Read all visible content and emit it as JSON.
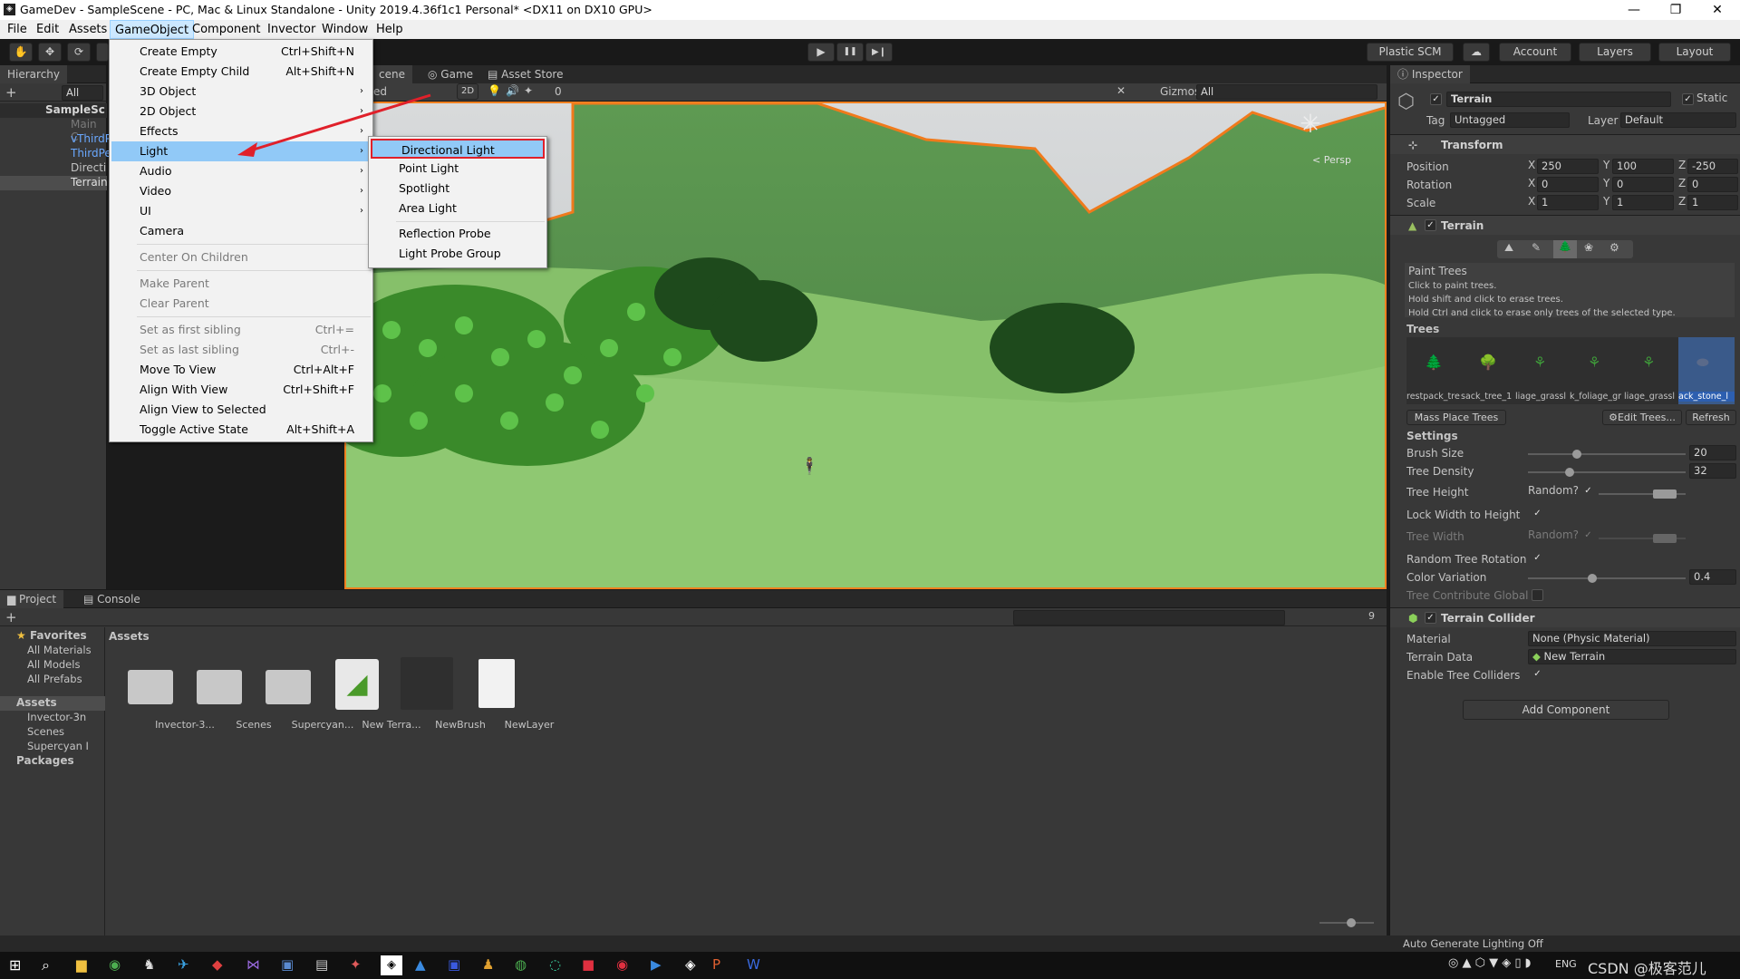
{
  "window": {
    "title": "GameDev - SampleScene - PC, Mac & Linux Standalone - Unity 2019.4.36f1c1 Personal* <DX11 on DX10 GPU>",
    "min": "—",
    "max": "❐",
    "close": "✕"
  },
  "menubar": [
    "File",
    "Edit",
    "Assets",
    "GameObject",
    "Component",
    "Invector",
    "Window",
    "Help"
  ],
  "toolbar": {
    "plastic": "Plastic SCM",
    "account": "Account",
    "layers": "Layers",
    "layout": "Layout",
    "play": "▶",
    "pause": "❚❚",
    "step": "▶❙"
  },
  "hierarchy": {
    "tab": "Hierarchy",
    "search": "All",
    "items": [
      "SampleSc",
      "Main C",
      "vThirdP",
      "ThirdPe",
      "Directi",
      "Terrain"
    ]
  },
  "scene": {
    "tabs": [
      "cene",
      "Game",
      "Asset Store"
    ],
    "shading": "ed",
    "mode2d": "2D",
    "hidden": "0",
    "gizmos": "Gizmos",
    "search": "All",
    "persp": "< Persp"
  },
  "gameobject_menu": {
    "items": [
      {
        "label": "Create Empty",
        "shortcut": "Ctrl+Shift+N",
        "sub": false,
        "disabled": false
      },
      {
        "label": "Create Empty Child",
        "shortcut": "Alt+Shift+N",
        "sub": false,
        "disabled": false
      },
      {
        "label": "3D Object",
        "shortcut": "",
        "sub": true,
        "disabled": false
      },
      {
        "label": "2D Object",
        "shortcut": "",
        "sub": true,
        "disabled": false
      },
      {
        "label": "Effects",
        "shortcut": "",
        "sub": true,
        "disabled": false
      },
      {
        "label": "Light",
        "shortcut": "",
        "sub": true,
        "disabled": false
      },
      {
        "label": "Audio",
        "shortcut": "",
        "sub": true,
        "disabled": false
      },
      {
        "label": "Video",
        "shortcut": "",
        "sub": true,
        "disabled": false
      },
      {
        "label": "UI",
        "shortcut": "",
        "sub": true,
        "disabled": false
      },
      {
        "label": "Camera",
        "shortcut": "",
        "sub": false,
        "disabled": false
      },
      {
        "label": "Center On Children",
        "shortcut": "",
        "sub": false,
        "disabled": true
      },
      {
        "label": "Make Parent",
        "shortcut": "",
        "sub": false,
        "disabled": true
      },
      {
        "label": "Clear Parent",
        "shortcut": "",
        "sub": false,
        "disabled": true
      },
      {
        "label": "Set as first sibling",
        "shortcut": "Ctrl+=",
        "sub": false,
        "disabled": true
      },
      {
        "label": "Set as last sibling",
        "shortcut": "Ctrl+-",
        "sub": false,
        "disabled": true
      },
      {
        "label": "Move To View",
        "shortcut": "Ctrl+Alt+F",
        "sub": false,
        "disabled": false
      },
      {
        "label": "Align With View",
        "shortcut": "Ctrl+Shift+F",
        "sub": false,
        "disabled": false
      },
      {
        "label": "Align View to Selected",
        "shortcut": "",
        "sub": false,
        "disabled": false
      },
      {
        "label": "Toggle Active State",
        "shortcut": "Alt+Shift+A",
        "sub": false,
        "disabled": false
      }
    ]
  },
  "light_submenu": [
    "Directional Light",
    "Point Light",
    "Spotlight",
    "Area Light",
    "Reflection Probe",
    "Light Probe Group"
  ],
  "inspector": {
    "tab": "Inspector",
    "object_name": "Terrain",
    "static": "Static",
    "tag_label": "Tag",
    "tag": "Untagged",
    "layer_label": "Layer",
    "layer": "Default",
    "transform": {
      "title": "Transform",
      "position": {
        "label": "Position",
        "x": "250",
        "y": "100",
        "z": "-250"
      },
      "rotation": {
        "label": "Rotation",
        "x": "0",
        "y": "0",
        "z": "0"
      },
      "scale": {
        "label": "Scale",
        "x": "1",
        "y": "1",
        "z": "1"
      }
    },
    "terrain": {
      "title": "Terrain",
      "paint_title": "Paint Trees",
      "help": [
        "Click to paint trees.",
        "Hold shift and click to erase trees.",
        "Hold Ctrl and click to erase only trees of the selected type."
      ],
      "trees_label": "Trees",
      "tree_items": [
        "restpack_tre",
        "sack_tree_1",
        "liage_grassl",
        "k_foliage_gr",
        "liage_grassl",
        "ack_stone_l"
      ],
      "mass_place": "Mass Place Trees",
      "edit_trees": "Edit Trees...",
      "refresh": "Refresh",
      "settings": "Settings",
      "brush_size": {
        "label": "Brush Size",
        "value": "20",
        "fraction": 0.3
      },
      "tree_density": {
        "label": "Tree Density",
        "value": "32",
        "fraction": 0.25
      },
      "tree_height": "Tree Height",
      "random": "Random?",
      "lock_width": "Lock Width to Height",
      "tree_width": "Tree Width",
      "random_rotation": "Random Tree Rotation",
      "color_variation": {
        "label": "Color Variation",
        "value": "0.4",
        "fraction": 0.4
      },
      "contribute_gi": "Tree Contribute Global I"
    },
    "collider": {
      "title": "Terrain Collider",
      "material_label": "Material",
      "material": "None (Physic Material)",
      "data_label": "Terrain Data",
      "data": "New Terrain",
      "enable_trees": "Enable Tree Colliders"
    },
    "add_component": "Add Component"
  },
  "project": {
    "tabs": [
      "Project",
      "Console"
    ],
    "favorites": "Favorites",
    "fav_items": [
      "All Materials",
      "All Models",
      "All Prefabs"
    ],
    "assets_root": "Assets",
    "asset_folders": [
      "Invector-3n",
      "Scenes",
      "Supercyan I"
    ],
    "packages": "Packages",
    "breadcrumb": "Assets",
    "hidden_count": "9",
    "assets": [
      "Invector-3...",
      "Scenes",
      "Supercyan...",
      "New Terra...",
      "NewBrush",
      "NewLayer"
    ]
  },
  "status": {
    "lighting": "Auto Generate Lighting Off"
  },
  "taskbar": {
    "tray": "ENG",
    "watermark": "CSDN @极客范儿"
  }
}
